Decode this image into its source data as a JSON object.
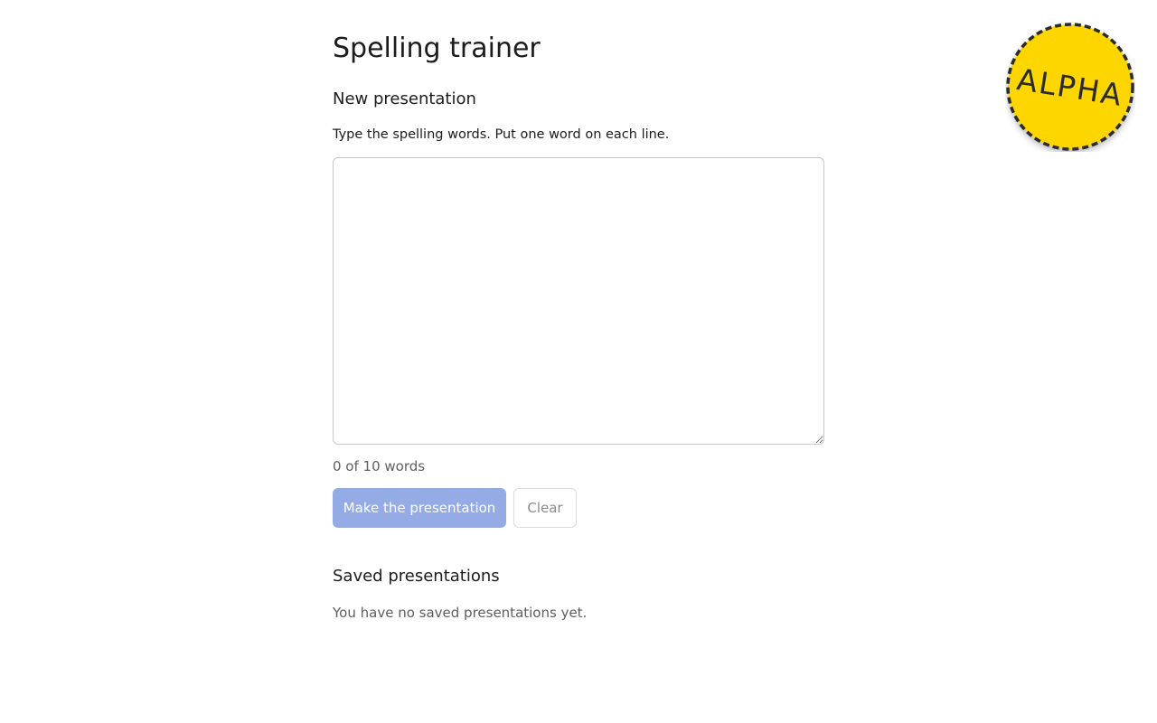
{
  "page": {
    "title": "Spelling trainer"
  },
  "new_presentation": {
    "heading": "New presentation",
    "instructions": "Type the spelling words. Put one word on each line.",
    "textarea_value": "",
    "word_count": "0 of 10 words",
    "make_button_label": "Make the presentation",
    "clear_button_label": "Clear"
  },
  "saved_presentations": {
    "heading": "Saved presentations",
    "empty_message": "You have no saved presentations yet."
  },
  "badge": {
    "label": "ALPHA",
    "fill_color": "#fdd600",
    "border_color": "#2b2b2b"
  },
  "colors": {
    "primary_button_disabled": "#95abe6"
  }
}
